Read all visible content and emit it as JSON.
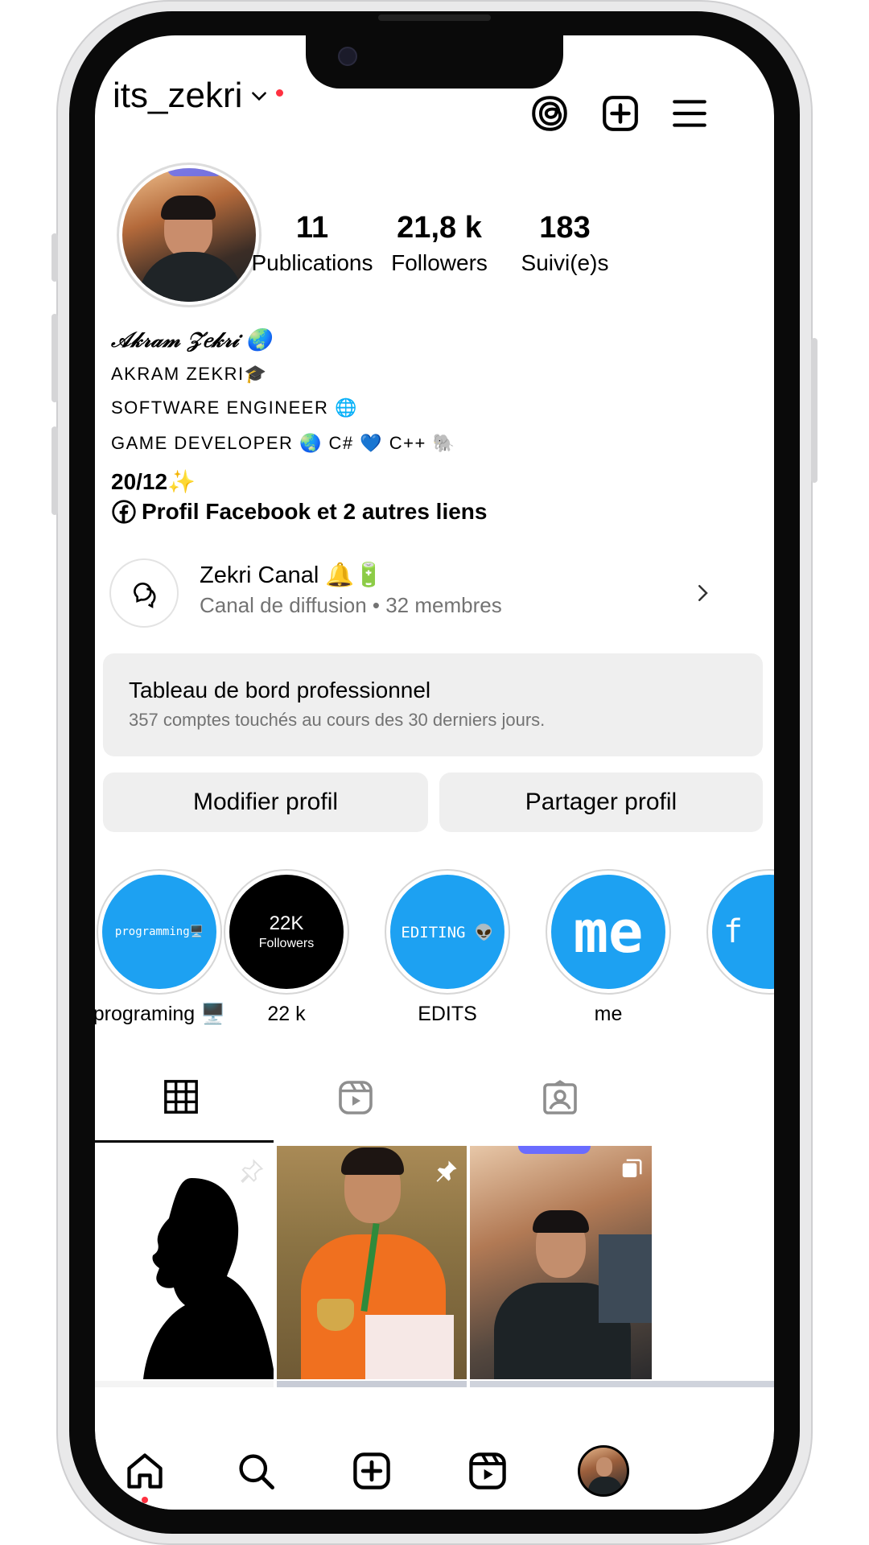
{
  "header": {
    "username": "its_zekri",
    "icons": [
      "chevron-down-icon",
      "threads-icon",
      "plus-square-icon",
      "menu-icon"
    ]
  },
  "stats": [
    {
      "value": "11",
      "label": "Publications"
    },
    {
      "value": "21,8 k",
      "label": "Followers"
    },
    {
      "value": "183",
      "label": "Suivi(e)s"
    }
  ],
  "bio": {
    "name": "𝒜𝓀𝓇𝒶𝓂 𝒵𝑒𝓀𝓇𝒾 🌏",
    "line1": "AKRAM ZEKRI🎓",
    "line2": "SOFTWARE ENGINEER 🌐",
    "line3": "GAME DEVELOPER 🌏 C# 💙 C++ 🐘",
    "line4": "20/12✨",
    "links": "Profil Facebook et 2 autres liens"
  },
  "channel": {
    "name": "Zekri Canal 🔔🔋",
    "subtitle": "Canal de diffusion • 32 membres"
  },
  "dashboard": {
    "title": "Tableau de bord professionnel",
    "subtitle": "357 comptes touchés au cours des 30 derniers jours."
  },
  "buttons": {
    "edit": "Modifier profil",
    "share": "Partager profil"
  },
  "highlights": [
    {
      "label": "programing 🖥️",
      "cover_text": "programming🖥️",
      "color": "#1da1f2"
    },
    {
      "label": "22 k",
      "cover_text": "22K",
      "cover_sub": "Followers",
      "color": "#000000"
    },
    {
      "label": "EDITS",
      "cover_text": "EDITING 👽",
      "color": "#1da1f2"
    },
    {
      "label": "me",
      "cover_text": "me",
      "color": "#1da1f2"
    },
    {
      "label": "",
      "cover_text": "f",
      "color": "#1da1f2"
    }
  ],
  "tabs": [
    "grid-icon",
    "reels-icon",
    "tagged-icon"
  ],
  "bottom_nav": [
    "home-icon",
    "search-icon",
    "create-icon",
    "reels-icon",
    "profile-avatar"
  ],
  "colors": {
    "accent_red": "#ff3040",
    "highlight_blue": "#1da1f2",
    "card_gray": "#efefef"
  }
}
